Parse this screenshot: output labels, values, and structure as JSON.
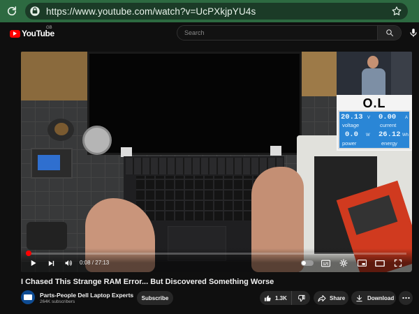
{
  "browser": {
    "url": "https://www.youtube.com/watch?v=UcPXkjpYU4s",
    "icons": [
      "reload-icon",
      "site-info-icon",
      "bookmark-star-icon"
    ]
  },
  "header": {
    "logo_text": "YouTube",
    "region_code": "GB",
    "search_placeholder": "Search",
    "icons": [
      "search-icon",
      "microphone-icon"
    ]
  },
  "video": {
    "overlay_display": {
      "top_text": "O.L",
      "voltage_value": "20.13",
      "voltage_unit": "V",
      "voltage_label": "voltage",
      "current_value": "0.00",
      "current_unit": "A",
      "current_label": "current",
      "power_value": "0.0",
      "power_unit": "W",
      "power_label": "power",
      "energy_value": "26.12",
      "energy_unit": "Wh",
      "energy_label": "energy"
    },
    "player": {
      "current_time": "0:08",
      "duration": "27:13",
      "time_display": "0:08 / 27:13",
      "progress_fraction": 0.005,
      "colors": {
        "progress": "#ff0000"
      },
      "icons": [
        "play-icon",
        "next-icon",
        "volume-icon",
        "autoplay-toggle",
        "subtitles-icon",
        "settings-gear-icon",
        "miniplayer-icon",
        "theater-mode-icon",
        "fullscreen-icon"
      ]
    }
  },
  "details": {
    "title": "I Chased This Strange RAM Error... But Discovered Something Worse",
    "channel_name": "Parts-People Dell Laptop Experts",
    "subscribers": "264K subscribers",
    "subscribe_label": "Subscribe",
    "like_count": "1.3K",
    "share_label": "Share",
    "download_label": "Download"
  }
}
